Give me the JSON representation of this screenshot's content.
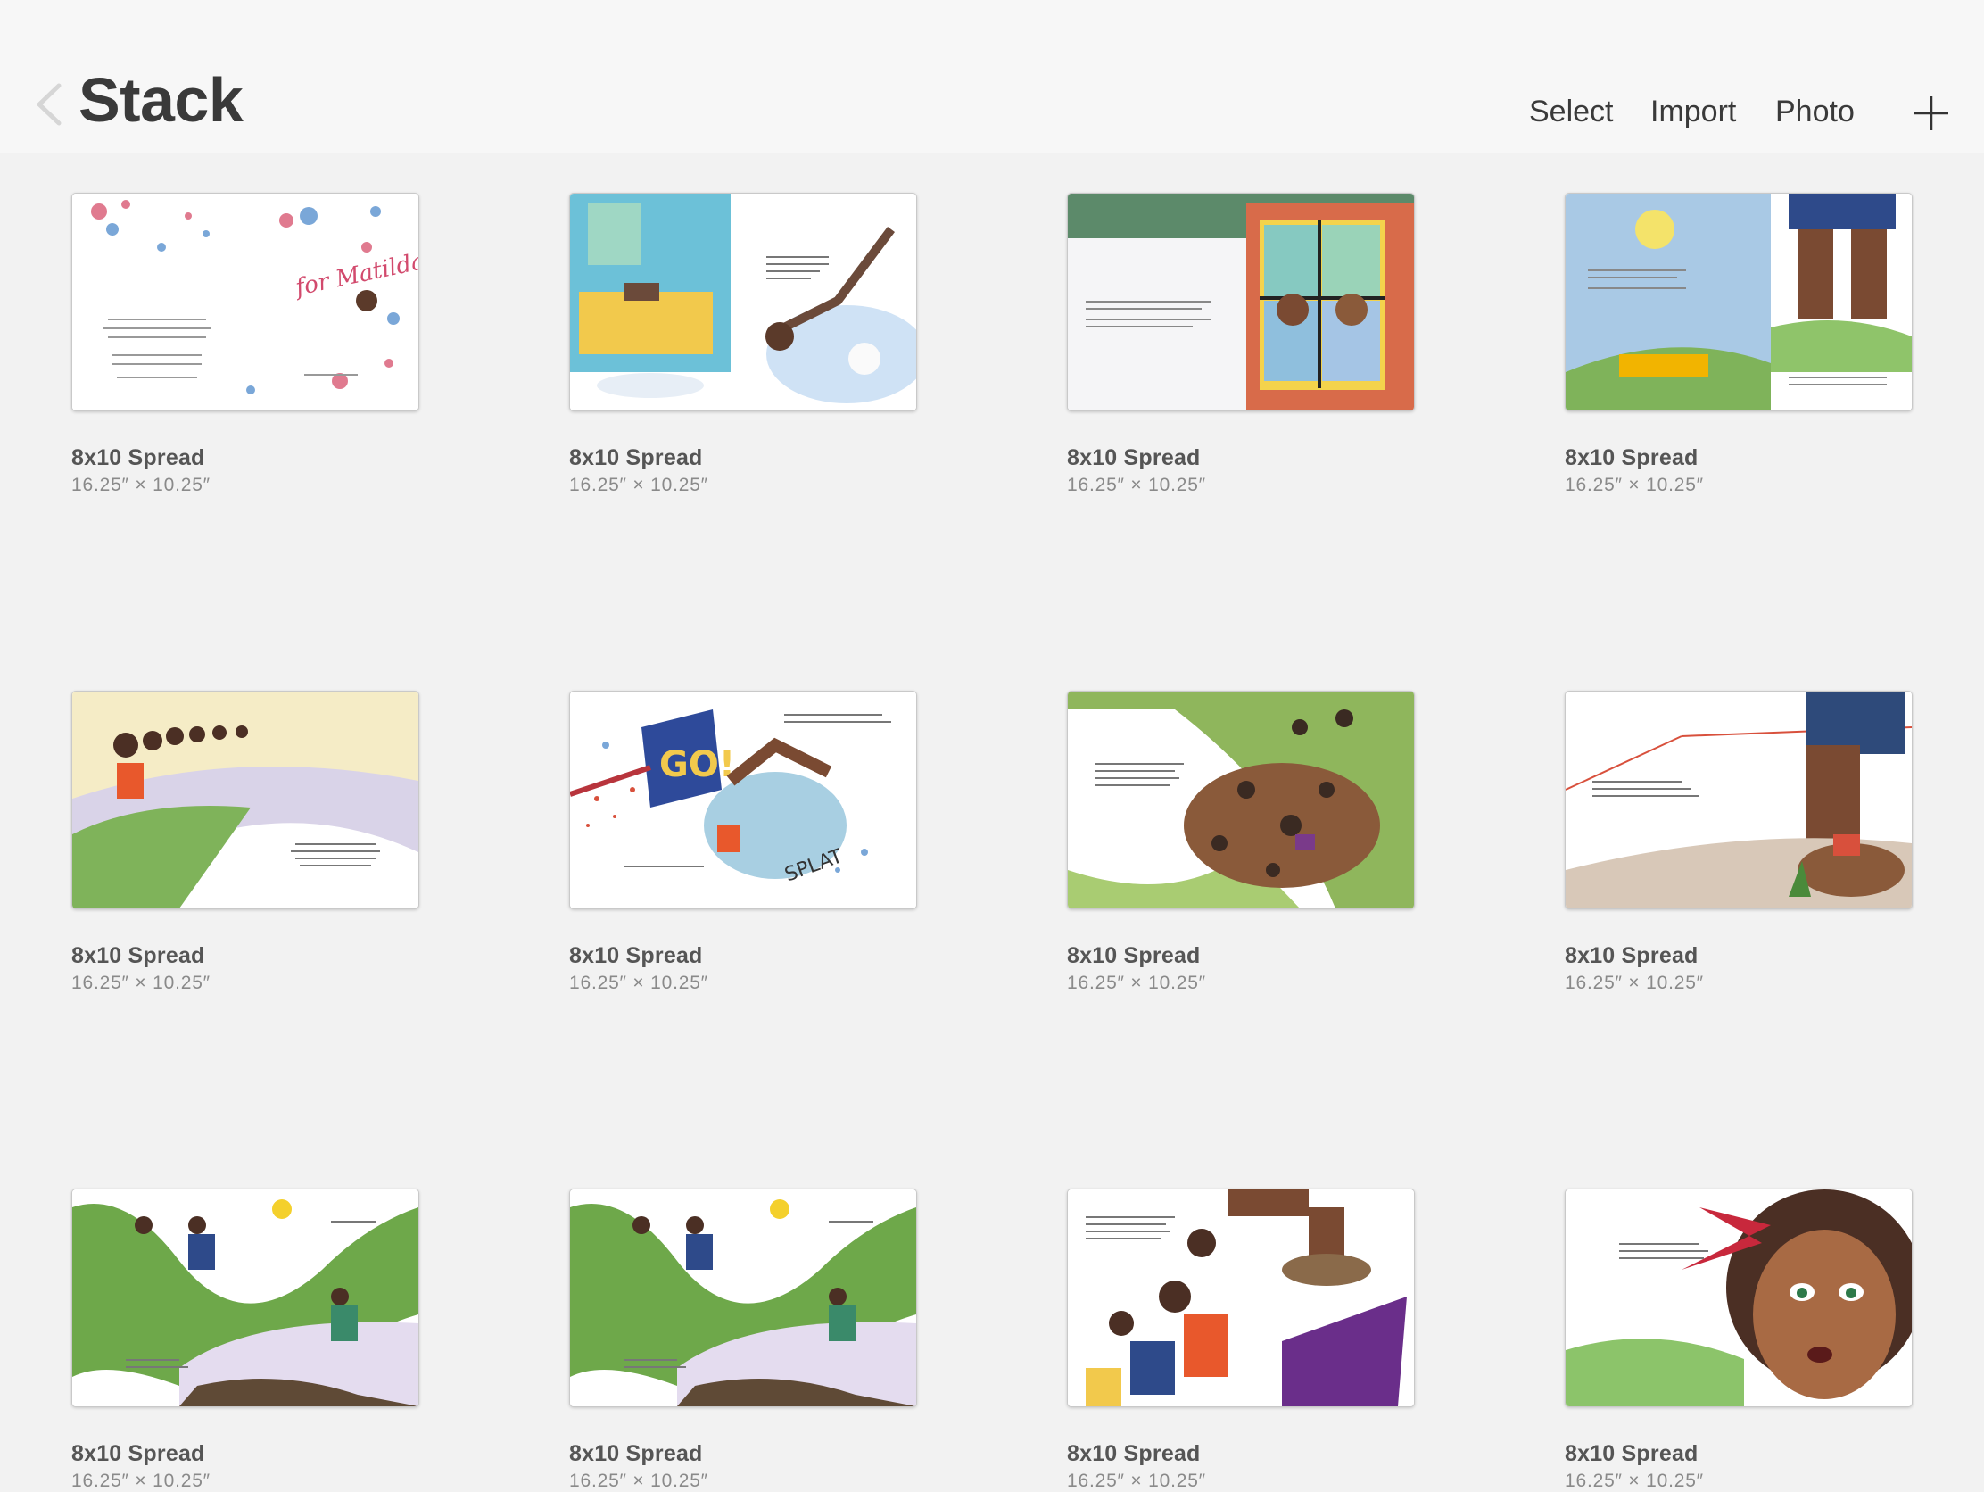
{
  "header": {
    "title": "Stack",
    "actions": {
      "select": "Select",
      "import": "Import",
      "photo": "Photo"
    }
  },
  "cards": [
    {
      "title": "8x10 Spread",
      "size": "16.25″ × 10.25″"
    },
    {
      "title": "8x10 Spread",
      "size": "16.25″ × 10.25″"
    },
    {
      "title": "8x10 Spread",
      "size": "16.25″ × 10.25″"
    },
    {
      "title": "8x10 Spread",
      "size": "16.25″ × 10.25″"
    },
    {
      "title": "8x10 Spread",
      "size": "16.25″ × 10.25″"
    },
    {
      "title": "8x10 Spread",
      "size": "16.25″ × 10.25″"
    },
    {
      "title": "8x10 Spread",
      "size": "16.25″ × 10.25″"
    },
    {
      "title": "8x10 Spread",
      "size": "16.25″ × 10.25″"
    },
    {
      "title": "8x10 Spread",
      "size": "16.25″ × 10.25″"
    },
    {
      "title": "8x10 Spread",
      "size": "16.25″ × 10.25″"
    },
    {
      "title": "8x10 Spread",
      "size": "16.25″ × 10.25″"
    },
    {
      "title": "8x10 Spread",
      "size": "16.25″ × 10.25″"
    }
  ],
  "artwork": {
    "spread_1": {
      "title_script": "for Matilda"
    },
    "spread_6": {
      "go_flag": "GO!",
      "splat": "SPLAT"
    }
  },
  "icons": {
    "back": "chevron-left-icon",
    "add": "plus-icon"
  }
}
